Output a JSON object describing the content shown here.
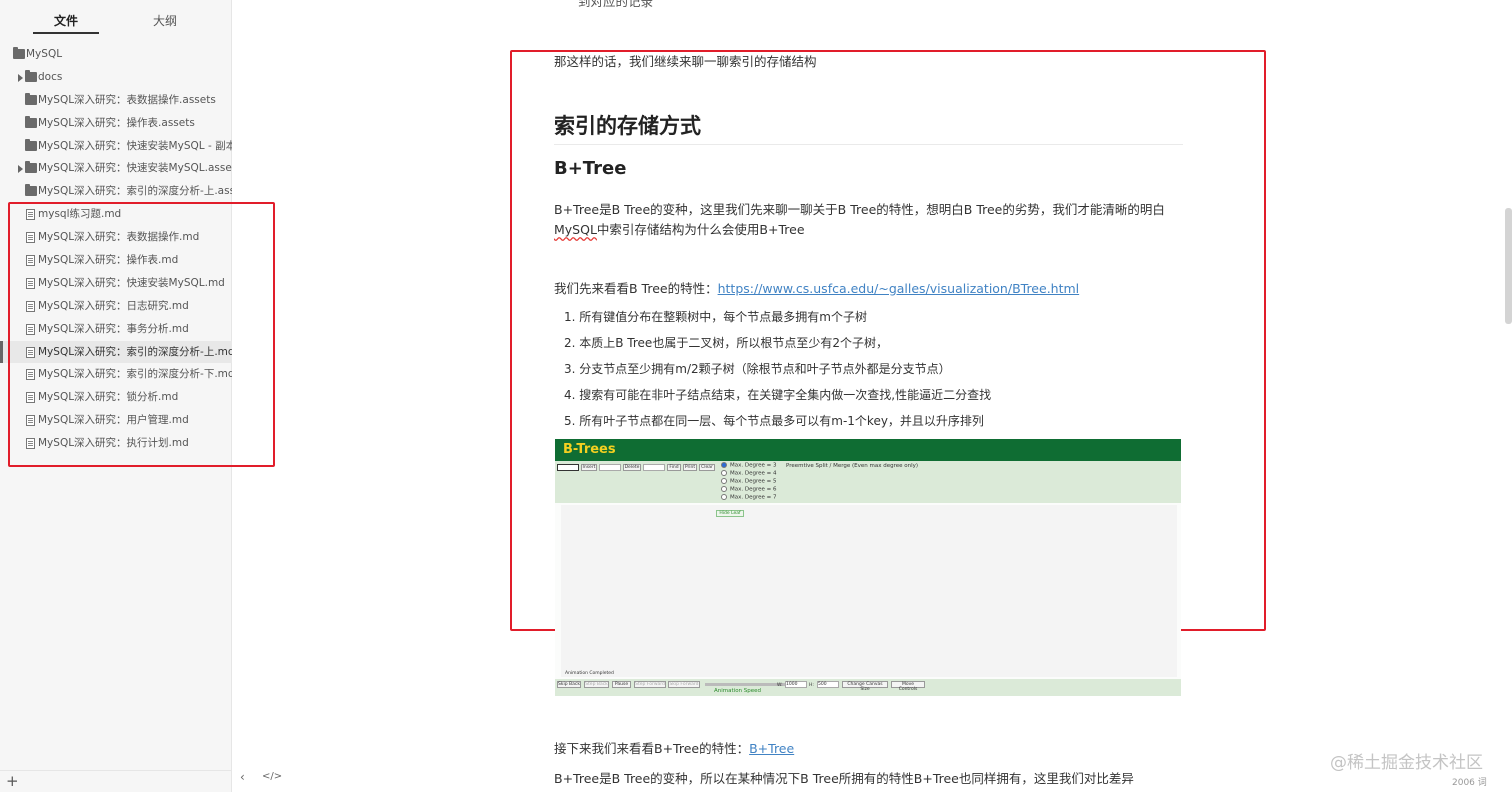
{
  "sidebar": {
    "tabs": {
      "files": "文件",
      "outline": "大纲"
    },
    "nodes": [
      {
        "label": "MySQL",
        "type": "folder"
      },
      {
        "label": "docs",
        "type": "folder"
      },
      {
        "label": "MySQL深入研究：表数据操作.assets",
        "type": "folder"
      },
      {
        "label": "MySQL深入研究：操作表.assets",
        "type": "folder"
      },
      {
        "label": "MySQL深入研究：快速安装MySQL - 副本",
        "type": "folder"
      },
      {
        "label": "MySQL深入研究：快速安装MySQL.assets",
        "type": "folder"
      },
      {
        "label": "MySQL深入研究：索引的深度分析-上.assets",
        "type": "folder"
      },
      {
        "label": "mysql练习题.md",
        "type": "file"
      },
      {
        "label": "MySQL深入研究：表数据操作.md",
        "type": "file"
      },
      {
        "label": "MySQL深入研究：操作表.md",
        "type": "file"
      },
      {
        "label": "MySQL深入研究：快速安装MySQL.md",
        "type": "file"
      },
      {
        "label": "MySQL深入研究：日志研究.md",
        "type": "file"
      },
      {
        "label": "MySQL深入研究：事务分析.md",
        "type": "file"
      },
      {
        "label": "MySQL深入研究：索引的深度分析-上.md",
        "type": "file"
      },
      {
        "label": "MySQL深入研究：索引的深度分析-下.md",
        "type": "file"
      },
      {
        "label": "MySQL深入研究：锁分析.md",
        "type": "file"
      },
      {
        "label": "MySQL深入研究：用户管理.md",
        "type": "file"
      },
      {
        "label": "MySQL深入研究：执行计划.md",
        "type": "file"
      }
    ],
    "plus": "+",
    "collapse": "‹",
    "source": "</>"
  },
  "content": {
    "top_cut": "到对应的记录",
    "intro": "那这样的话，我们继续来聊一聊索引的存储结构",
    "h1": "索引的存储方式",
    "h2": "B+Tree",
    "p1_line1": "B+Tree是B Tree的变种，这里我们先来聊一聊关于B Tree的特性，想明白B Tree的劣势，我们才能清晰的明白",
    "p1_mysql": "MySQL",
    "p1_line2_rest": "中索引存储结构为什么会使用B+Tree",
    "p2_prefix": "我们先来看看B Tree的特性：",
    "p2_link": "https://www.cs.usfca.edu/~galles/visualization/BTree.html",
    "list": [
      "1. 所有键值分布在整颗树中，每个节点最多拥有m个子树",
      "2. 本质上B Tree也属于二叉树，所以根节点至少有2个子树，",
      "3. 分支节点至少拥有m/2颗子树（除根节点和叶子节点外都是分支节点）",
      "4. 搜索有可能在非叶子结点结束，在关键字全集内做一次查找,性能逼近二分查找",
      "5. 所有叶子节点都在同一层、每个节点最多可以有m-1个key，并且以升序排列"
    ],
    "p3_prefix": "接下来我们来看看B+Tree的特性：",
    "p3_link": "B+Tree",
    "p4": "B+Tree是B Tree的变种，所以在某种情况下B Tree所拥有的特性B+Tree也同样拥有，这里我们对比差异"
  },
  "btree_image": {
    "title": "B-Trees",
    "buttons": [
      "Insert",
      "Delete",
      "Find",
      "Print",
      "Clear"
    ],
    "degrees": [
      "Max. Degree = 3",
      "Max. Degree = 4",
      "Max. Degree = 5",
      "Max. Degree = 6",
      "Max. Degree = 7"
    ],
    "note": "Preemtive Split / Merge (Even max degree only)",
    "hide_btn": "Hide Leaf",
    "anim_status": "Animation Completed",
    "footer_buttons": [
      "Skip Back",
      "Step Back",
      "Pause",
      "Step Forward",
      "Skip Forward"
    ],
    "speed": "Animation Speed",
    "w_label": "W:",
    "w_value": "1000",
    "h_label": "H:",
    "h_value": "500",
    "canvas_btn": "Change Canvas Size",
    "move_btn": "Move Controls"
  },
  "watermark": "@稀土掘金技术社区",
  "wordcount": "2006 词",
  "colors": {
    "highlight_box": "#e11d2a",
    "link": "#4183c4",
    "btree_header": "#0f6d33",
    "btree_title": "#f5d020"
  }
}
